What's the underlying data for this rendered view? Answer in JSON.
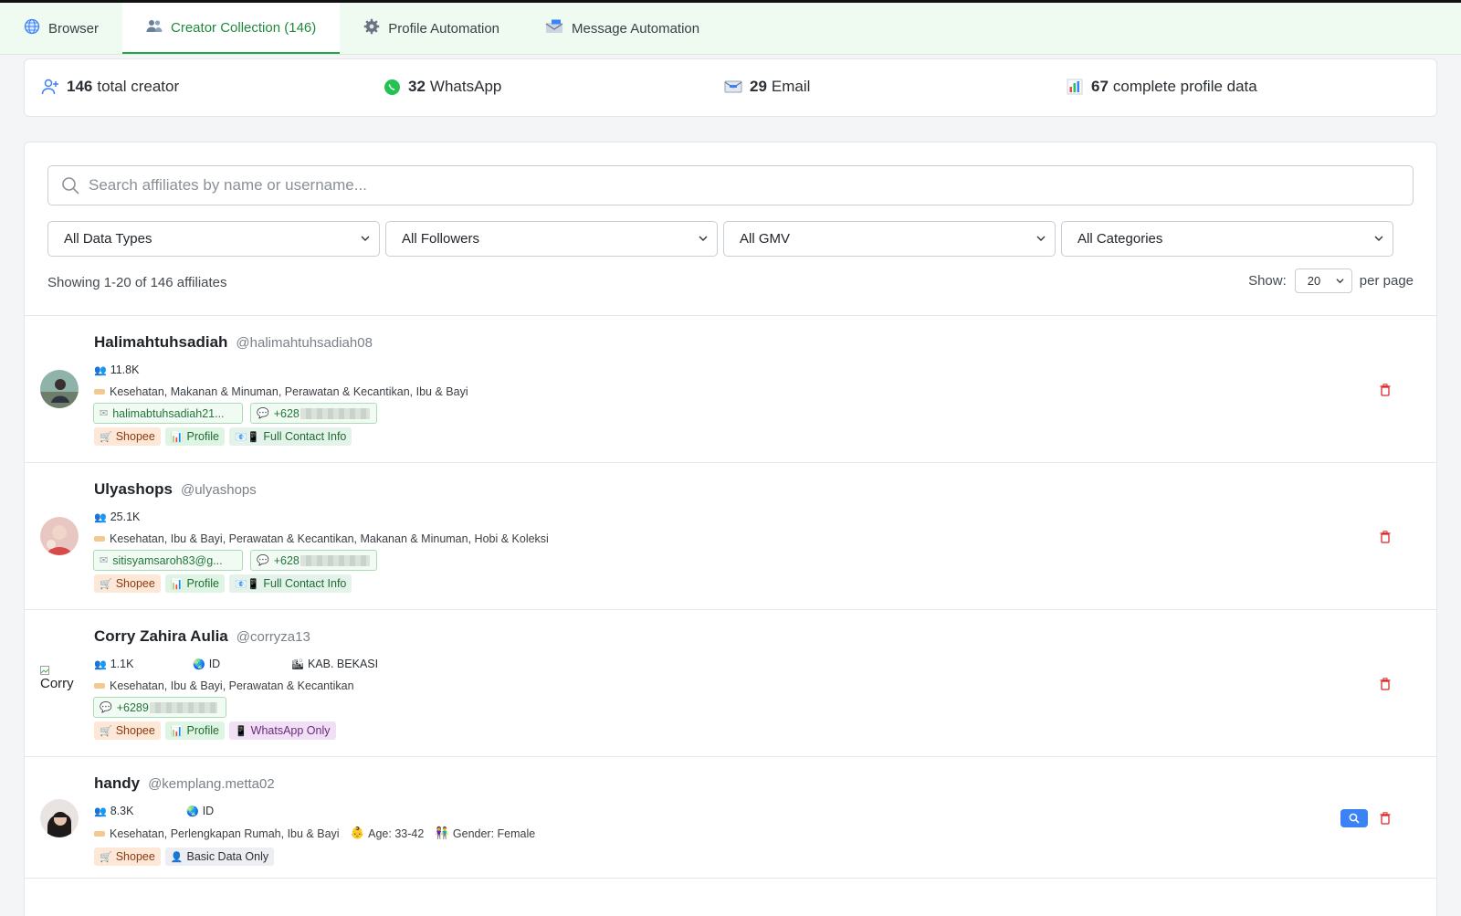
{
  "tabs": [
    {
      "label": "Browser",
      "icon": "globe-icon",
      "active": false
    },
    {
      "label": "Creator Collection (146)",
      "icon": "users-icon",
      "active": true
    },
    {
      "label": "Profile Automation",
      "icon": "gear-icon",
      "active": false
    },
    {
      "label": "Message Automation",
      "icon": "mail-icon",
      "active": false
    }
  ],
  "stats": {
    "total": {
      "value": "146",
      "label": "total creator"
    },
    "whatsapp": {
      "value": "32",
      "label": "WhatsApp"
    },
    "email": {
      "value": "29",
      "label": "Email"
    },
    "complete": {
      "value": "67",
      "label": "complete profile data"
    }
  },
  "search": {
    "placeholder": "Search affiliates by name or username..."
  },
  "filters": {
    "data_types": "All Data Types",
    "followers": "All Followers",
    "gmv": "All GMV",
    "categories": "All Categories"
  },
  "pagination": {
    "showing": "Showing 1-20 of 146 affiliates",
    "show_label": "Show:",
    "per_page_value": "20",
    "per_page_label": "per page"
  },
  "creators": [
    {
      "name": "Halimahtuhsadiah",
      "username": "@halimahtuhsadiah08",
      "followers": "11.8K",
      "categories": "Kesehatan, Makanan & Minuman, Perawatan & Kecantikan, Ibu & Bayi",
      "email": "halimabtuhsadiah21...",
      "phone": "+628",
      "badges": [
        "Shopee",
        "Profile",
        "Full Contact Info"
      ]
    },
    {
      "name": "Ulyashops",
      "username": "@ulyashops",
      "followers": "25.1K",
      "categories": "Kesehatan, Ibu & Bayi, Perawatan & Kecantikan, Makanan & Minuman, Hobi & Koleksi",
      "email": "sitisyamsaroh83@g...",
      "phone": "+628",
      "badges": [
        "Shopee",
        "Profile",
        "Full Contact Info"
      ]
    },
    {
      "name": "Corry Zahira Aulia",
      "username": "@corryza13",
      "followers": "1.1K",
      "country": "ID",
      "city": "KAB. BEKASI",
      "avatar_alt": "Corry",
      "categories": "Kesehatan, Ibu & Bayi, Perawatan & Kecantikan",
      "phone": "+6289",
      "badges": [
        "Shopee",
        "Profile",
        "WhatsApp Only"
      ]
    },
    {
      "name": "handy",
      "username": "@kemplang.metta02",
      "followers": "8.3K",
      "country": "ID",
      "categories": "Kesehatan, Perlengkapan Rumah, Ibu & Bayi",
      "age": "Age: 33-42",
      "gender": "Gender: Female",
      "badges": [
        "Shopee",
        "Basic Data Only"
      ]
    }
  ]
}
